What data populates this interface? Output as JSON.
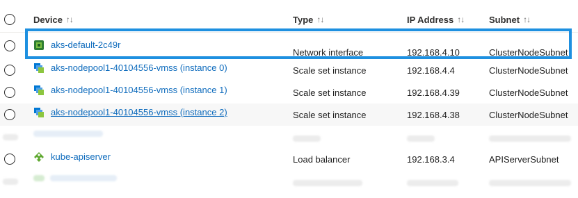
{
  "columns": {
    "device": "Device",
    "type": "Type",
    "ip": "IP Address",
    "subnet": "Subnet",
    "sort_icon": "sort-arrows-icon",
    "sort_glyph": "↑↓"
  },
  "rows": [
    {
      "device": "aks-default-2c49r",
      "icon": "network-interface-icon",
      "type": "Network interface",
      "ip": "192.168.4.10",
      "subnet": "ClusterNodeSubnet",
      "highlighted": true
    },
    {
      "device": "aks-nodepool1-40104556-vmss (instance 0)",
      "icon": "scale-set-icon",
      "type": "Scale set instance",
      "ip": "192.168.4.4",
      "subnet": "ClusterNodeSubnet"
    },
    {
      "device": "aks-nodepool1-40104556-vmss (instance 1)",
      "icon": "scale-set-icon",
      "type": "Scale set instance",
      "ip": "192.168.4.39",
      "subnet": "ClusterNodeSubnet"
    },
    {
      "device": "aks-nodepool1-40104556-vmss (instance 2)",
      "icon": "scale-set-icon",
      "type": "Scale set instance",
      "ip": "192.168.4.38",
      "subnet": "ClusterNodeSubnet"
    },
    {
      "device": "kube-apiserver",
      "icon": "load-balancer-icon",
      "type": "Load balancer",
      "ip": "192.168.3.4",
      "subnet": "APIServerSubnet"
    }
  ],
  "colors": {
    "link": "#0f6cbd",
    "highlight_border": "#1e90e0",
    "alt_row": "#f7f7f7"
  }
}
